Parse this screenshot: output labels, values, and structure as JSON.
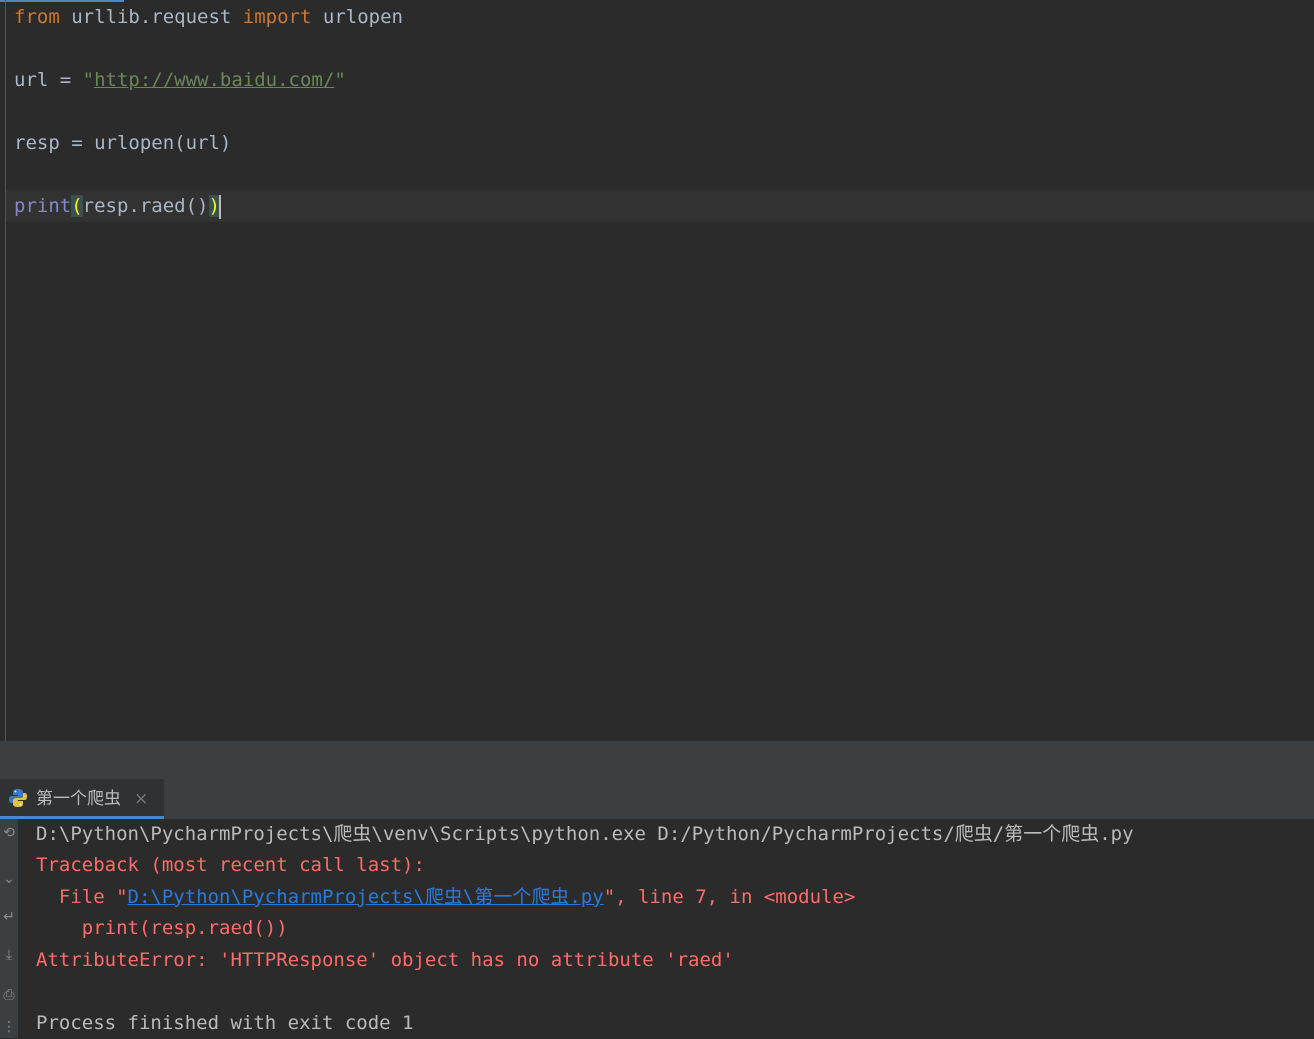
{
  "editor": {
    "line1": {
      "kw_from": "from",
      "module": " urllib.request ",
      "kw_import": "import",
      "name": " urlopen"
    },
    "line2": {
      "lhs": "url = ",
      "quote_open": "\"",
      "url": "http://www.baidu.com/",
      "quote_close": "\""
    },
    "line3": {
      "code": "resp = urlopen(url)"
    },
    "line4": {
      "builtin": "print",
      "paren_open": "(",
      "middle": "resp.raed()",
      "paren_close": ")"
    }
  },
  "run_panel": {
    "tab_label": "第一个爬虫",
    "close_glyph": "×",
    "command": "D:\\Python\\PycharmProjects\\爬虫\\venv\\Scripts\\python.exe D:/Python/PycharmProjects/爬虫/第一个爬虫.py",
    "traceback_header": "Traceback (most recent call last):",
    "file_prefix": "  File \"",
    "file_link": "D:\\Python\\PycharmProjects\\爬虫\\第一个爬虫.py",
    "file_suffix": "\", line 7, in <module>",
    "code_line": "    print(resp.raed())",
    "error": "AttributeError: 'HTTPResponse' object has no attribute 'raed'",
    "exit_message": "Process finished with exit code 1"
  },
  "colors": {
    "keyword": "#cc7832",
    "string": "#6a8759",
    "builtin": "#8888c6",
    "error": "#ff6b68",
    "link": "#287bde"
  },
  "icons": [
    "python-icon",
    "close-icon",
    "rerun-icon",
    "stop-icon",
    "scroll-down-icon",
    "soft-wrap-icon",
    "print-icon"
  ]
}
